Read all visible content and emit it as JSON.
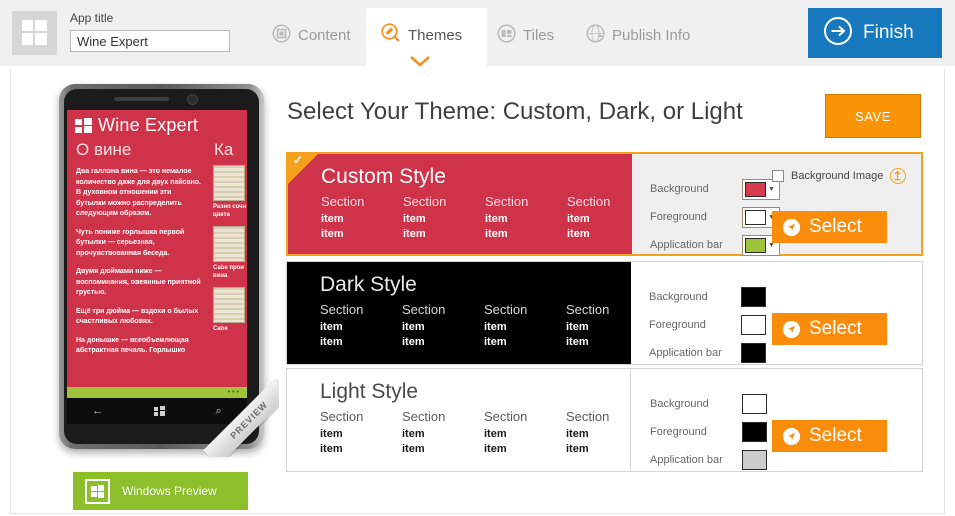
{
  "header": {
    "app_title_label": "App title",
    "app_title_value": "Wine Expert",
    "app_title_placeholder": "App title",
    "logo_icon": "windows-logo-icon",
    "tabs": [
      {
        "label": "Content",
        "icon": "content-icon",
        "active": false
      },
      {
        "label": "Themes",
        "icon": "themes-paint-icon",
        "active": true
      },
      {
        "label": "Tiles",
        "icon": "tiles-icon",
        "active": false
      },
      {
        "label": "Publish Info",
        "icon": "publish-globe-icon",
        "active": false
      }
    ],
    "finish_label": "Finish",
    "finish_icon": "arrow-right-circle-icon",
    "finish_color": "#1878be"
  },
  "main": {
    "page_title": "Select Your Theme: Custom, Dark, or Light",
    "save_label": "SAVE",
    "save_color": "#f89406",
    "accent_color": "#f5a11d"
  },
  "phone_preview": {
    "app_name": "Wine Expert",
    "section_1": "О вине",
    "section_2": "Ка",
    "paragraphs": [
      "Два галлона вина — это немалое количество даже для двух пайсано. В духовном отношении эти бутылки можно распределить следующим образом.",
      "Чуть пониже горлышка первой бутылки — серьезная, прочувствованная беседа.",
      "Двумя дюймами ниже — воспоминания, овеянные приятной грустью.",
      "Ещё три дюйма — вздохи о былых счастливых любовях.",
      "На донышке — всеобъемлющая абстрактная печаль. Горлышко"
    ],
    "captions": [
      "Разно сочн цвета",
      "Cabe прои вина",
      "Cabe"
    ],
    "nav_icons": [
      "back-arrow-icon",
      "windows-home-icon",
      "search-icon"
    ],
    "ribbon_label": "PREVIEW",
    "appbar_color": "#9fc33b",
    "background_color": "#cf3349",
    "windows_preview_label": "Windows Preview",
    "windows_preview_color": "#8cc02a"
  },
  "themes": {
    "section_labels": [
      "Section",
      "Section",
      "Section",
      "Section"
    ],
    "item_labels": [
      "item",
      "item"
    ],
    "swatch_labels": [
      "Background",
      "Foreground",
      "Application bar"
    ],
    "background_image_label": "Background Image",
    "background_image_checked": false,
    "select_label": "Select",
    "rows": [
      {
        "name": "Custom Style",
        "selected": true,
        "preview_bg": "#cf3349",
        "swatches": [
          "#d93a4e",
          "#ffffff",
          "#9fc33b"
        ],
        "has_dropdown": true,
        "has_background_image": true
      },
      {
        "name": "Dark Style",
        "selected": false,
        "preview_bg": "#000000",
        "swatches": [
          "#000000",
          "#ffffff",
          "#000000"
        ],
        "has_dropdown": false,
        "has_background_image": false
      },
      {
        "name": "Light Style",
        "selected": false,
        "preview_bg": "#ffffff",
        "swatches": [
          "#ffffff",
          "#000000",
          "#cccccc"
        ],
        "has_dropdown": false,
        "has_background_image": false
      }
    ]
  }
}
